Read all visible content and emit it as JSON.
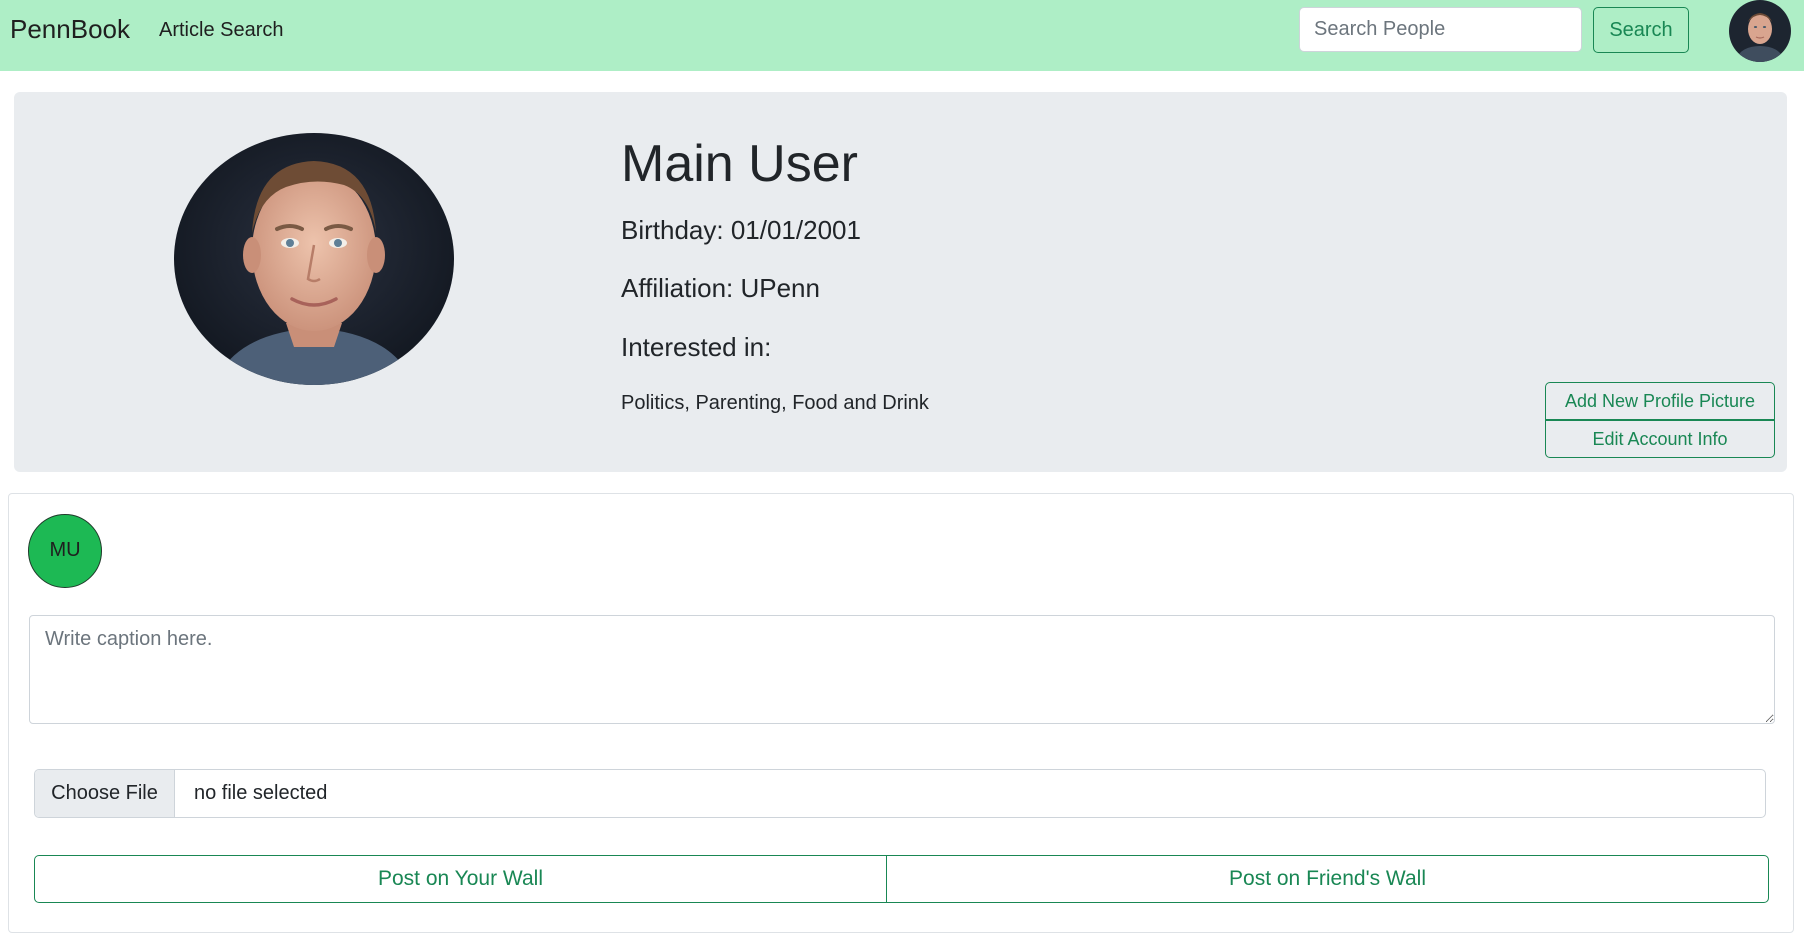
{
  "navbar": {
    "brand": "PennBook",
    "links": [
      {
        "label": "Article Search"
      }
    ],
    "search_placeholder": "Search People",
    "search_label": "Search",
    "avatar_icon": "user-avatar-photo"
  },
  "profile": {
    "name": "Main User",
    "birthday": "Birthday: 01/01/2001",
    "affiliation": "Affiliation: UPenn",
    "interested_label": "Interested in:",
    "interests": "Politics, Parenting, Food and Drink",
    "photo_icon": "profile-photo",
    "buttons": {
      "add_picture": "Add New Profile Picture",
      "edit_account": "Edit Account Info"
    }
  },
  "composer": {
    "avatar_initials": "MU",
    "caption_placeholder": "Write caption here.",
    "choose_file_label": "Choose File",
    "file_status": "no file selected",
    "post_own_label": "Post on Your Wall",
    "post_friend_label": "Post on Friend's Wall"
  },
  "colors": {
    "navbar_bg": "#aeeec6",
    "accent": "#198754",
    "card_bg": "#e9ecef",
    "avatar_green": "#1db954"
  }
}
